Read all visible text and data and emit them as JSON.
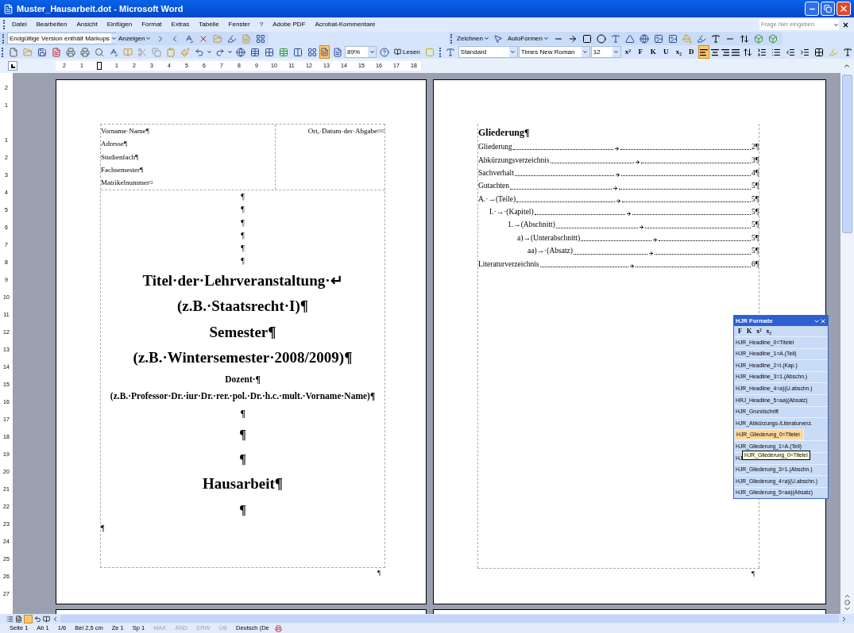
{
  "window": {
    "title": "Muster_Hausarbeit.dot - Microsoft Word"
  },
  "menu": [
    "Datei",
    "Bearbeiten",
    "Ansicht",
    "Einfügen",
    "Format",
    "Extras",
    "Tabelle",
    "Fenster",
    "?",
    "Adobe PDF",
    "Acrobat-Kommentare"
  ],
  "help_field": {
    "placeholder": "Frage hier eingeben"
  },
  "review_toolbar": {
    "markup_view": "Endgültige Version enthält Markups",
    "show_button": "Anzeigen"
  },
  "drawing_toolbar": {
    "draw_button": "Zeichnen",
    "autoshapes_button": "AutoFormen"
  },
  "standard_toolbar": {
    "zoom": "89%",
    "read_button": "Lesen"
  },
  "formatting_toolbar": {
    "style": "Standard",
    "font": "Times New Roman",
    "size": "12",
    "buttons": [
      {
        "label": "x²"
      },
      {
        "label": "F"
      },
      {
        "label": "K"
      },
      {
        "label": "U"
      },
      {
        "label": "x₂"
      },
      {
        "label": "D"
      }
    ],
    "alignment": [
      {
        "kind": "left",
        "selected": true
      },
      {
        "kind": "center",
        "selected": false
      },
      {
        "kind": "right",
        "selected": false
      },
      {
        "kind": "justify",
        "selected": false
      }
    ]
  },
  "horizontal_ruler": [
    "2",
    "1",
    "1",
    "2",
    "3",
    "4",
    "5",
    "6",
    "7",
    "8",
    "9",
    "10",
    "11",
    "12",
    "13",
    "14",
    "15",
    "16",
    "17",
    "18"
  ],
  "vertical_ruler": [
    "2",
    "1",
    "1",
    "2",
    "3",
    "4",
    "5",
    "6",
    "7",
    "8",
    "9",
    "10",
    "11",
    "12",
    "13",
    "14",
    "15",
    "16",
    "17",
    "18",
    "19",
    "20",
    "21",
    "22",
    "23",
    "24",
    "25",
    "26",
    "27"
  ],
  "title_page": {
    "header_left": [
      "Vorname·Name¶",
      "Adresse¶",
      "Studienfach¶",
      "Fachsemester¶",
      "Matrikelnummer¤"
    ],
    "header_right": "Ort,·Datum·der·Abgabe¤¤",
    "paragraphs": [
      {
        "kind": "mark",
        "text": "¶"
      },
      {
        "kind": "mark",
        "text": "¶"
      },
      {
        "kind": "mark",
        "text": "¶"
      },
      {
        "kind": "mark",
        "text": "¶"
      },
      {
        "kind": "mark",
        "text": "¶"
      },
      {
        "kind": "mark",
        "text": "¶"
      },
      {
        "kind": "title",
        "text": "Titel·der·Lehrveranstaltung·↵"
      },
      {
        "kind": "title",
        "text": "(z.B.·Staatsrecht·I)¶"
      },
      {
        "kind": "title",
        "text": "Semester¶"
      },
      {
        "kind": "title",
        "text": "(z.B.·Wintersemester·2008/2009)¶"
      },
      {
        "kind": "bold",
        "text": "Dozent·¶"
      },
      {
        "kind": "bold",
        "text": "(z.B.·Professor·Dr.·iur·Dr.·rer.·pol.·Dr.·h.c.·mult.·Vorname·Name)¶"
      },
      {
        "kind": "bold",
        "text": "¶"
      },
      {
        "kind": "large",
        "text": "¶"
      },
      {
        "kind": "large",
        "text": "¶"
      },
      {
        "kind": "title",
        "text": "Hausarbeit¶"
      },
      {
        "kind": "large",
        "text": "¶"
      },
      {
        "kind": "left",
        "text": "¶"
      }
    ],
    "footer": "¶"
  },
  "outline_page": {
    "heading": "Gliederung¶",
    "footer": "¶",
    "entries": [
      {
        "label": "Gliederung",
        "page": "2¶"
      },
      {
        "label": "Abkürzungsverzeichnis",
        "page": "3¶"
      },
      {
        "label": "Sachverhalt",
        "page": "4¶"
      },
      {
        "label": "Gutachten",
        "page": "5¶"
      },
      {
        "label": "A.·→(Teile)",
        "page": "5¶",
        "children": [
          {
            "label": "I.·→·(Kapitel)",
            "page": "5¶",
            "children": [
              {
                "label": "1.→(Abschnitt)",
                "page": "5¶",
                "children": [
                  {
                    "label": "a)→(Unterabschnitt)",
                    "page": "5¶",
                    "children": [
                      {
                        "label": "aa)→·(Absatz)",
                        "page": "5¶"
                      }
                    ]
                  }
                ]
              }
            ]
          }
        ]
      },
      {
        "label": "Literaturverzeichnis",
        "page": "6¶"
      }
    ]
  },
  "formats_palette": {
    "title": "HJR Formate",
    "buttons": [
      {
        "label": "F"
      },
      {
        "label": "K"
      },
      {
        "label": "x²"
      },
      {
        "label": "x₂"
      }
    ],
    "items": [
      {
        "label": "HJR_Headline_0=Titelei",
        "selected": false
      },
      {
        "label": "HJR_Headline_1=A.(Teil)",
        "selected": false
      },
      {
        "label": "HJR_Headline_2=I.(Kap.)",
        "selected": false
      },
      {
        "label": "HJR_Headline_3=1.(Abschn.)",
        "selected": false
      },
      {
        "label": "HJR_Headline_4=a)(U.abschn.)",
        "selected": false
      },
      {
        "label": "HRJ_Headline_5=aa)(Absatz)",
        "selected": false
      },
      {
        "label": "HJR_Grundschrift",
        "selected": false
      },
      {
        "label": "HJR_Abkürzungs-/Literaturverz.",
        "selected": false
      },
      {
        "label": "HJR_Gliederung_0=Titelei",
        "selected": true
      },
      {
        "label": "HJR_Gliederung_1=A.(Teil)",
        "selected": false
      },
      {
        "label": "HJ",
        "selected": false
      },
      {
        "label": "HJR_Gliederung_3=1.(Abschn.)",
        "selected": false
      },
      {
        "label": "HJR_Gliederung_4=a)(U.abschn.)",
        "selected": false
      },
      {
        "label": "HJR_Gliederung_5=aa)(Absatz)",
        "selected": false
      }
    ],
    "tooltip": "HJR_Gliederung_0=Titelei"
  },
  "status_bar": [
    {
      "text": "Seite 1",
      "disabled": false
    },
    {
      "text": "Ab 1",
      "disabled": false
    },
    {
      "text": "1/6",
      "disabled": false
    },
    {
      "text": "Bei 2,5 cm",
      "disabled": false
    },
    {
      "text": "Ze 1",
      "disabled": false
    },
    {
      "text": "Sp 1",
      "disabled": false
    },
    {
      "text": "MAK",
      "disabled": true
    },
    {
      "text": "ÄND",
      "disabled": true
    },
    {
      "text": "ERW",
      "disabled": true
    },
    {
      "text": "ÜB",
      "disabled": true
    },
    {
      "text": "Deutsch (De",
      "disabled": false
    }
  ]
}
